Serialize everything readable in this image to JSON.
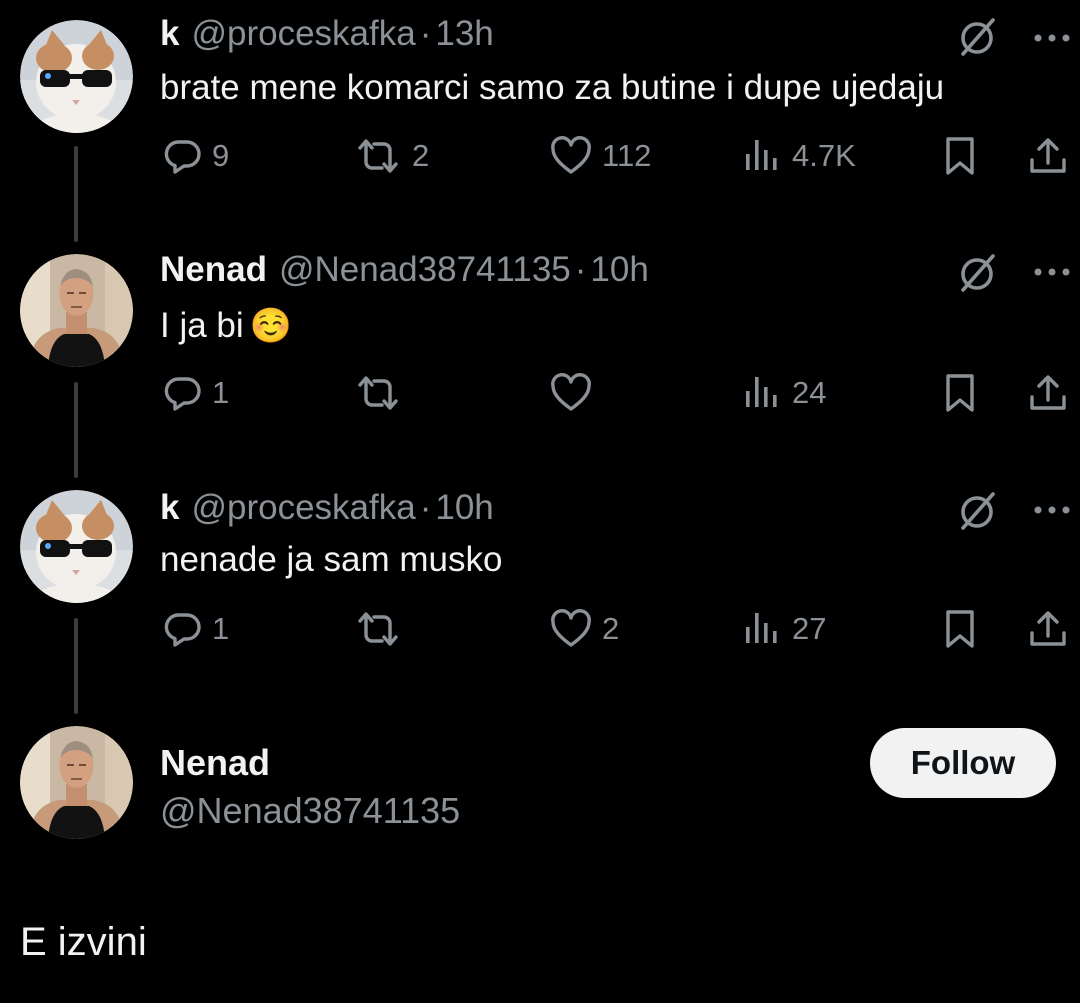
{
  "thread": [
    {
      "avatar_icon": "cat-with-sunglasses-avatar",
      "name": "k",
      "handle": "@proceskafka",
      "separator": "·",
      "time": "13h",
      "text": "brate mene komarci samo za butine i dupe ujedaju",
      "replies": "9",
      "reposts": "2",
      "likes": "112",
      "views": "4.7K"
    },
    {
      "avatar_icon": "man-portrait-avatar",
      "name": "Nenad",
      "handle": "@Nenad38741135",
      "separator": "·",
      "time": "10h",
      "text": "I ja bi",
      "emoji": "☺️",
      "replies": "1",
      "reposts": "",
      "likes": "",
      "views": "24"
    },
    {
      "avatar_icon": "cat-with-sunglasses-avatar",
      "name": "k",
      "handle": "@proceskafka",
      "separator": "·",
      "time": "10h",
      "text": "nenade ja sam musko",
      "replies": "1",
      "reposts": "",
      "likes": "2",
      "views": "27"
    }
  ],
  "profile_card": {
    "avatar_icon": "man-portrait-avatar",
    "name": "Nenad",
    "handle": "@Nenad38741135",
    "follow_label": "Follow"
  },
  "caption": "E izvini",
  "icons": {
    "reply": "reply-icon",
    "repost": "repost-icon",
    "like": "heart-icon",
    "views": "views-icon",
    "bookmark": "bookmark-icon",
    "share": "share-icon",
    "grok": "grok-icon",
    "more": "more-icon"
  },
  "colors": {
    "background": "#000000",
    "text_primary": "#f2f2f2",
    "text_secondary": "#8b9196",
    "follow_button_bg": "#f2f2f2",
    "follow_button_text": "#0f1419"
  }
}
